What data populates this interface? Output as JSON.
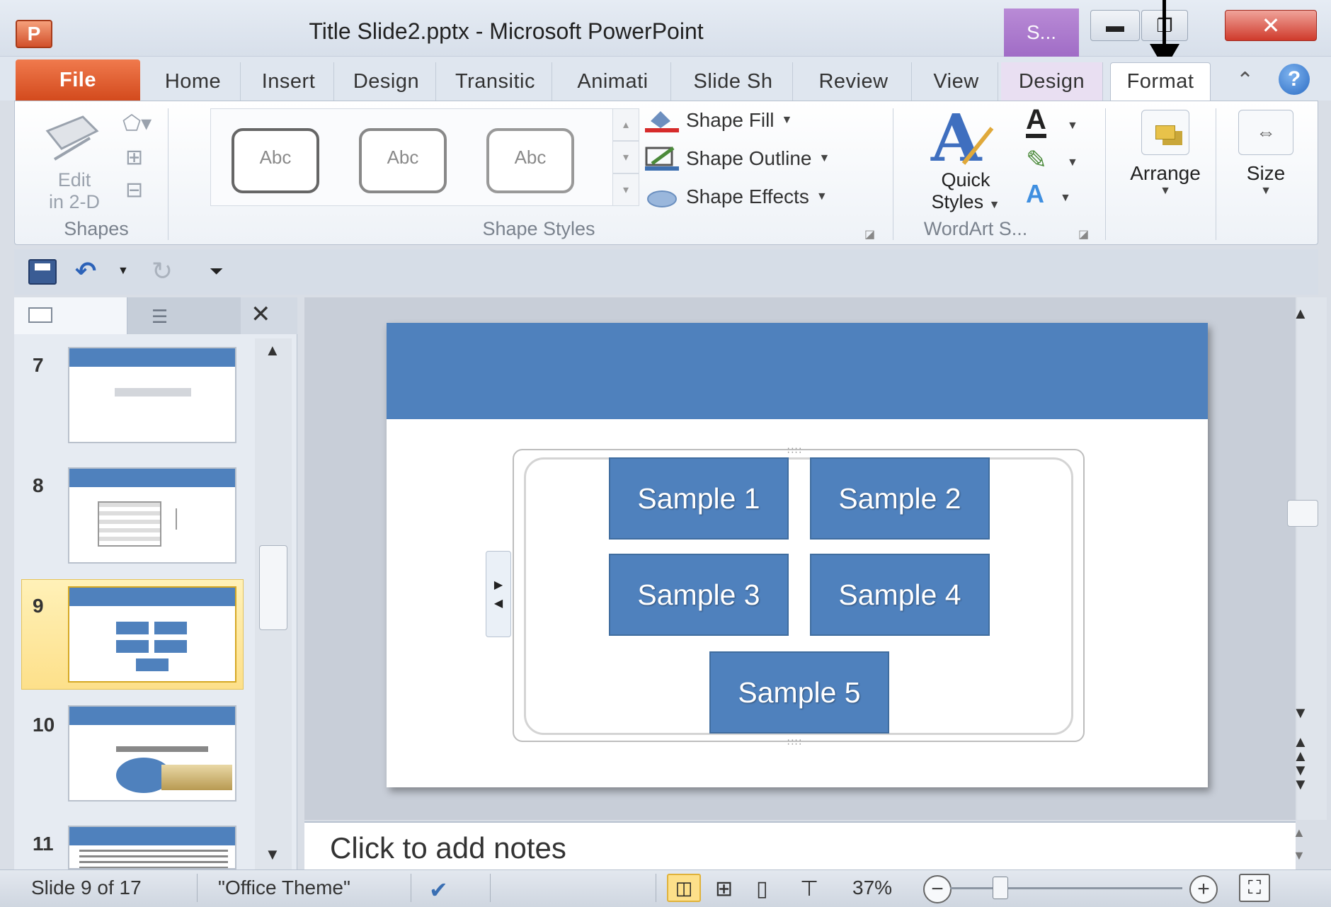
{
  "window": {
    "title": "Title Slide2.pptx  -  Microsoft PowerPoint",
    "app_icon_letter": "P",
    "context_group_label": "S..."
  },
  "tabs": [
    "File",
    "Home",
    "Insert",
    "Design",
    "Transitic",
    "Animati",
    "Slide Sh",
    "Review",
    "View",
    "Design",
    "Format"
  ],
  "active_tab": "Format",
  "ribbon": {
    "shapes_group": {
      "label": "Shapes",
      "edit_2d": [
        "Edit",
        "in 2-D"
      ]
    },
    "shape_styles_group": {
      "label": "Shape Styles",
      "gallery_items": [
        "Abc",
        "Abc",
        "Abc"
      ],
      "commands": [
        "Shape Fill",
        "Shape Outline",
        "Shape Effects"
      ]
    },
    "wordart_group": {
      "label": "WordArt S...",
      "quick_styles": [
        "Quick",
        "Styles"
      ]
    },
    "arrange": {
      "label": "Arrange"
    },
    "size": {
      "label": "Size"
    }
  },
  "slides_panel": {
    "thumbnails": [
      {
        "number": "7"
      },
      {
        "number": "8"
      },
      {
        "number": "9",
        "selected": true
      },
      {
        "number": "10"
      },
      {
        "number": "11"
      }
    ]
  },
  "slide": {
    "header_color": "#4f81bd",
    "shapes": [
      "Sample 1",
      "Sample 2",
      "Sample 3",
      "Sample 4",
      "Sample 5"
    ]
  },
  "notes_placeholder": "Click to add notes",
  "status_bar": {
    "slide_info": "Slide 9 of 17",
    "theme": "\"Office Theme\"",
    "zoom": "37%"
  },
  "icons": {
    "minimize": "minimize-icon",
    "maximize": "maximize-icon",
    "close": "close-icon",
    "help": "help-icon",
    "save": "save-icon",
    "undo": "undo-icon",
    "redo": "redo-icon"
  },
  "colors": {
    "accent": "#4f81bd",
    "file_tab": "#d34a1d",
    "context_tab": "#a06cc6",
    "selected_slide": "#fde08a"
  }
}
